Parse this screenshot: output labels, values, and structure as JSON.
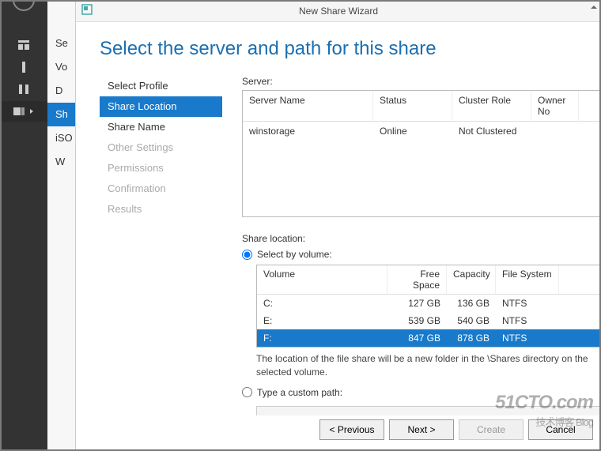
{
  "window": {
    "title": "New Share Wizard"
  },
  "outer_sidebar": {
    "items": [
      "Se",
      "Vo",
      "D",
      "Sh",
      "iSO",
      "W"
    ],
    "selected_index": 3
  },
  "page": {
    "title": "Select the server and path for this share"
  },
  "steps": {
    "items": [
      {
        "label": "Select Profile",
        "state": "done"
      },
      {
        "label": "Share Location",
        "state": "current"
      },
      {
        "label": "Share Name",
        "state": "done"
      },
      {
        "label": "Other Settings",
        "state": "disabled"
      },
      {
        "label": "Permissions",
        "state": "disabled"
      },
      {
        "label": "Confirmation",
        "state": "disabled"
      },
      {
        "label": "Results",
        "state": "disabled"
      }
    ]
  },
  "server_section": {
    "label": "Server:",
    "headers": {
      "name": "Server Name",
      "status": "Status",
      "role": "Cluster Role",
      "owner": "Owner No"
    },
    "rows": [
      {
        "name": "winstorage",
        "status": "Online",
        "role": "Not Clustered",
        "owner": ""
      }
    ]
  },
  "share_location": {
    "label": "Share location:",
    "radio_volume": "Select by volume:",
    "radio_custom": "Type a custom path:",
    "radio_selected": "volume",
    "vol_headers": {
      "vol": "Volume",
      "free": "Free Space",
      "cap": "Capacity",
      "fs": "File System"
    },
    "volumes": [
      {
        "vol": "C:",
        "free": "127 GB",
        "cap": "136 GB",
        "fs": "NTFS",
        "sel": false
      },
      {
        "vol": "E:",
        "free": "539 GB",
        "cap": "540 GB",
        "fs": "NTFS",
        "sel": false
      },
      {
        "vol": "F:",
        "free": "847 GB",
        "cap": "878 GB",
        "fs": "NTFS",
        "sel": true
      }
    ],
    "hint": "The location of the file share will be a new folder in the \\Shares directory on the selected volume.",
    "custom_path": ""
  },
  "buttons": {
    "previous": "< Previous",
    "next": "Next >",
    "create": "Create",
    "cancel": "Cancel"
  },
  "watermark": {
    "main": "51CTO.com",
    "sub": "技术博客  Blog"
  }
}
